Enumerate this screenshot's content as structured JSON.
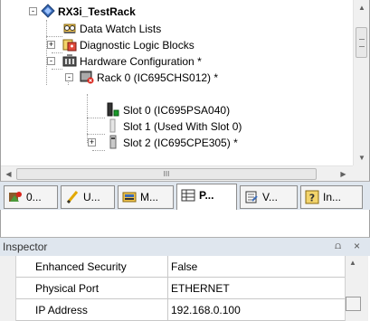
{
  "tree": {
    "nodes": [
      {
        "label": "RX3i_TestRack",
        "bold": true,
        "icon": "rack-diamond-icon",
        "expander": "-"
      },
      {
        "label": "Data Watch Lists",
        "bold": false,
        "icon": "data-watch-icon",
        "expander": ""
      },
      {
        "label": "Diagnostic Logic Blocks",
        "bold": false,
        "icon": "logic-blocks-icon",
        "expander": "+"
      },
      {
        "label": "Hardware Configuration *",
        "bold": false,
        "icon": "hardware-config-icon",
        "expander": "-"
      },
      {
        "label": "Rack 0 (IC695CHS012) *",
        "bold": false,
        "icon": "rack-error-icon",
        "expander": "-"
      },
      {
        "label": "Slot 0 (IC695PSA040)",
        "bold": false,
        "icon": "power-supply-icon",
        "expander": ""
      },
      {
        "label": "Slot 1 (Used With Slot 0)",
        "bold": false,
        "icon": "empty-slot-icon",
        "expander": ""
      },
      {
        "label": "Slot 2 (IC695CPE305) *",
        "bold": false,
        "icon": "cpu-module-icon",
        "expander": "+"
      }
    ],
    "hscroll_grip": "III"
  },
  "tabs": [
    {
      "label": "0...",
      "icon": "project-tab-icon",
      "active": false
    },
    {
      "label": "U...",
      "icon": "utilities-tab-icon",
      "active": false
    },
    {
      "label": "M...",
      "icon": "manager-tab-icon",
      "active": false
    },
    {
      "label": "P...",
      "icon": "project-grid-tab-icon",
      "active": true
    },
    {
      "label": "V...",
      "icon": "variables-tab-icon",
      "active": false
    },
    {
      "label": "In...",
      "icon": "help-tab-icon",
      "active": false
    }
  ],
  "inspector": {
    "title": "Inspector",
    "pin_glyph": "⩍",
    "close_glyph": "×",
    "rows": [
      {
        "name": "Enhanced Security",
        "value": "False"
      },
      {
        "name": "Physical Port",
        "value": "ETHERNET"
      },
      {
        "name": "IP Address",
        "value": "192.168.0.100"
      }
    ]
  },
  "colors": {
    "panel_header": "#dfe6ee",
    "grid_lines": "#c8c8c8",
    "tree_lines": "#a0a0a0"
  }
}
